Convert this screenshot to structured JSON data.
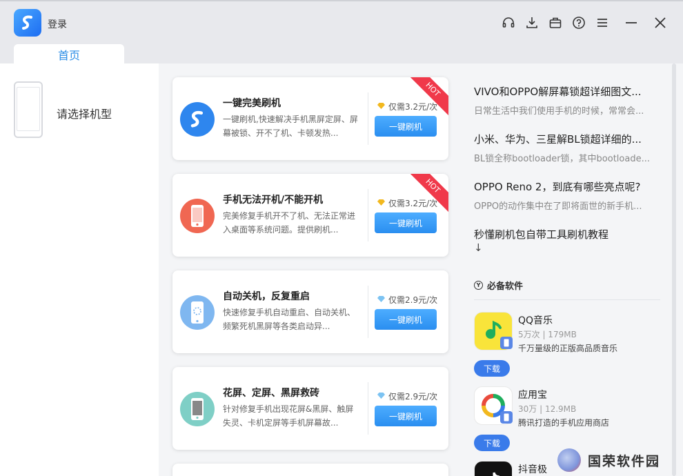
{
  "header": {
    "login_label": "登录",
    "tab_home": "首页",
    "icons": [
      "headset-icon",
      "download-icon",
      "toolbox-icon",
      "help-icon",
      "menu-icon",
      "minimize-icon",
      "close-icon"
    ]
  },
  "left": {
    "select_model_label": "请选择机型"
  },
  "cards": [
    {
      "title": "一键完美刷机",
      "desc": "一键刷机,快速解决手机黑屏定屏、屏幕被锁、开不了机、卡顿发热...",
      "price": "仅需3.2元/次",
      "button": "一键刷机",
      "hot": "HOT",
      "icon_color": "#2e86ee"
    },
    {
      "title": "手机无法开机/不能开机",
      "desc": "完美修复手机开不了机、无法正常进入桌面等系统问题。提供刷机...",
      "price": "仅需3.2元/次",
      "button": "一键刷机",
      "hot": "HOT",
      "icon_color": "#f06752"
    },
    {
      "title": "自动关机，反复重启",
      "desc": "快速修复手机自动重启、自动关机、频繁死机黑屏等各类启动异...",
      "price": "仅需2.9元/次",
      "button": "一键刷机",
      "hot": "",
      "icon_color": "#7fb7f0"
    },
    {
      "title": "花屏、定屏、黑屏救砖",
      "desc": "针对修复手机出现花屏&黑屏、触屏失灵、卡机定屏等手机屏幕故...",
      "price": "仅需2.9元/次",
      "button": "一键刷机",
      "hot": "",
      "icon_color": "#7fcfc6"
    }
  ],
  "articles": [
    {
      "title": "VIVO和OPPO解屏幕锁超详细图文...",
      "sub": "日常生活中我们使用手机的时候，常常会..."
    },
    {
      "title": "小米、华为、三星解BL锁超详细的...",
      "sub": "BL锁全称bootloader锁，其中bootloade..."
    },
    {
      "title": "OPPO Reno 2，到底有哪些亮点呢?",
      "sub": "OPPO的动作集中在了即将面世的新手机..."
    },
    {
      "title": "秒懂刷机包自带工具刷机教程",
      "sub": ""
    }
  ],
  "arrow": "↓",
  "must_have": {
    "badge": "Y",
    "title": "必备软件",
    "apps": [
      {
        "name": "QQ音乐",
        "meta": "5万次 | 179MB",
        "desc": "千万量级的正版高品质音乐",
        "button": "下载"
      },
      {
        "name": "应用宝",
        "meta": "30万 | 12.9MB",
        "desc": "腾讯打造的手机应用商店",
        "button": "下载"
      },
      {
        "name": "抖音极",
        "meta": "",
        "desc": "",
        "button": ""
      }
    ]
  },
  "watermark": "国荣软件园"
}
